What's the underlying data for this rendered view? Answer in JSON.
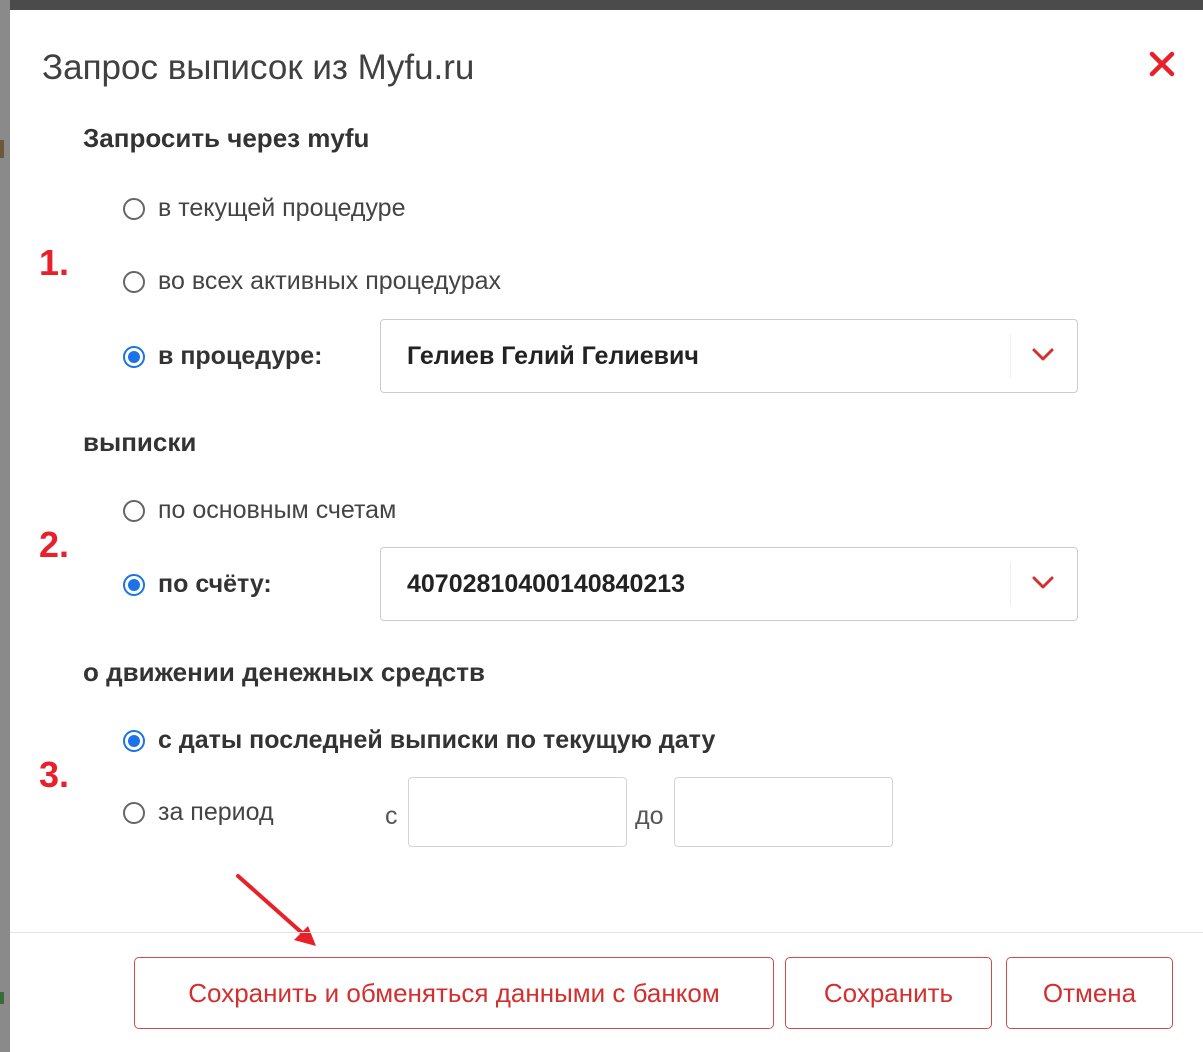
{
  "dialog": {
    "title": "Запрос выписок из Myfu.ru",
    "close_icon": "close-x-icon",
    "accent_color": "#e8202a",
    "radio_color": "#1a73e8"
  },
  "step_markers": [
    "1.",
    "2.",
    "3."
  ],
  "request_via": {
    "heading": "Запросить через myfu",
    "options": [
      {
        "label": "в текущей процедуре",
        "checked": false
      },
      {
        "label": "во всех активных процедурах",
        "checked": false
      },
      {
        "label": "в процедуре:",
        "checked": true
      }
    ],
    "procedure_select": {
      "value": "Гелиев Гелий Гелиевич",
      "icon": "chevron-down-icon"
    }
  },
  "statements": {
    "heading": "выписки",
    "options": [
      {
        "label": "по основным счетам",
        "checked": false
      },
      {
        "label": "по счёту:",
        "checked": true
      }
    ],
    "account_select": {
      "value": "40702810400140840213",
      "icon": "chevron-down-icon"
    }
  },
  "cash_flow": {
    "heading": "о движении денежных средств",
    "options": [
      {
        "label": "с даты последней выписки по текущую дату",
        "checked": true
      },
      {
        "label": "за период",
        "checked": false
      }
    ],
    "from_label": "с",
    "to_label": "до",
    "from_value": "",
    "to_value": ""
  },
  "footer": {
    "save_exchange_label": "Сохранить и обменяться данными с банком",
    "save_label": "Сохранить",
    "cancel_label": "Отмена"
  },
  "annotation_arrow": {
    "icon": "red-arrow-icon",
    "color": "#e8202a"
  }
}
